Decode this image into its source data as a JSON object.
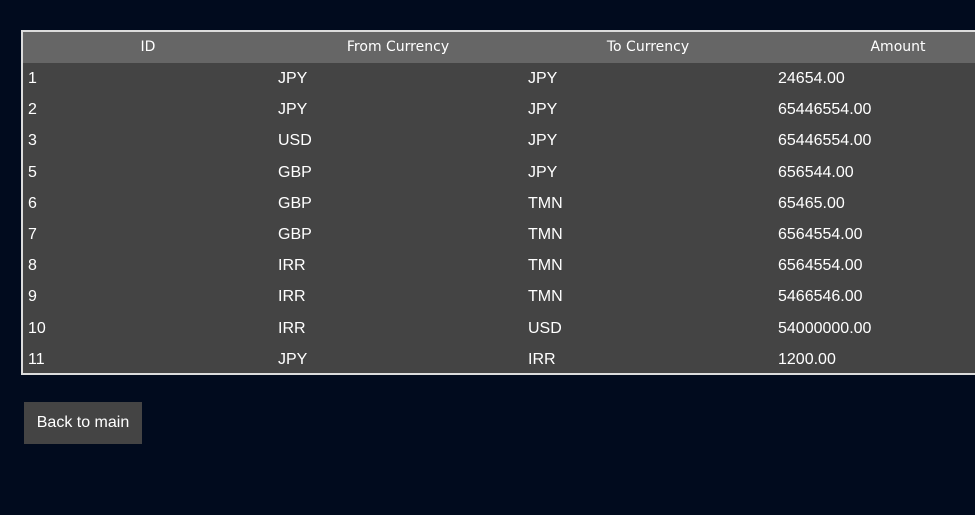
{
  "table": {
    "columns": [
      "ID",
      "From Currency",
      "To Currency",
      "Amount"
    ],
    "rows": [
      {
        "id": "1",
        "from": "JPY",
        "to": "JPY",
        "amount": "24654.00"
      },
      {
        "id": "2",
        "from": "JPY",
        "to": "JPY",
        "amount": "65446554.00"
      },
      {
        "id": "3",
        "from": "USD",
        "to": "JPY",
        "amount": "65446554.00"
      },
      {
        "id": "5",
        "from": "GBP",
        "to": "JPY",
        "amount": "656544.00"
      },
      {
        "id": "6",
        "from": "GBP",
        "to": "TMN",
        "amount": "65465.00"
      },
      {
        "id": "7",
        "from": "GBP",
        "to": "TMN",
        "amount": "6564554.00"
      },
      {
        "id": "8",
        "from": "IRR",
        "to": "TMN",
        "amount": "6564554.00"
      },
      {
        "id": "9",
        "from": "IRR",
        "to": "TMN",
        "amount": "5466546.00"
      },
      {
        "id": "10",
        "from": "IRR",
        "to": "USD",
        "amount": "54000000.00"
      },
      {
        "id": "11",
        "from": "JPY",
        "to": "IRR",
        "amount": "1200.00"
      }
    ]
  },
  "actions": {
    "back_label": "Back to main"
  },
  "colors": {
    "background": "#010b1e",
    "table_body": "#444444",
    "table_header": "#666666",
    "border": "#dcdcdc",
    "text": "#ffffff"
  }
}
